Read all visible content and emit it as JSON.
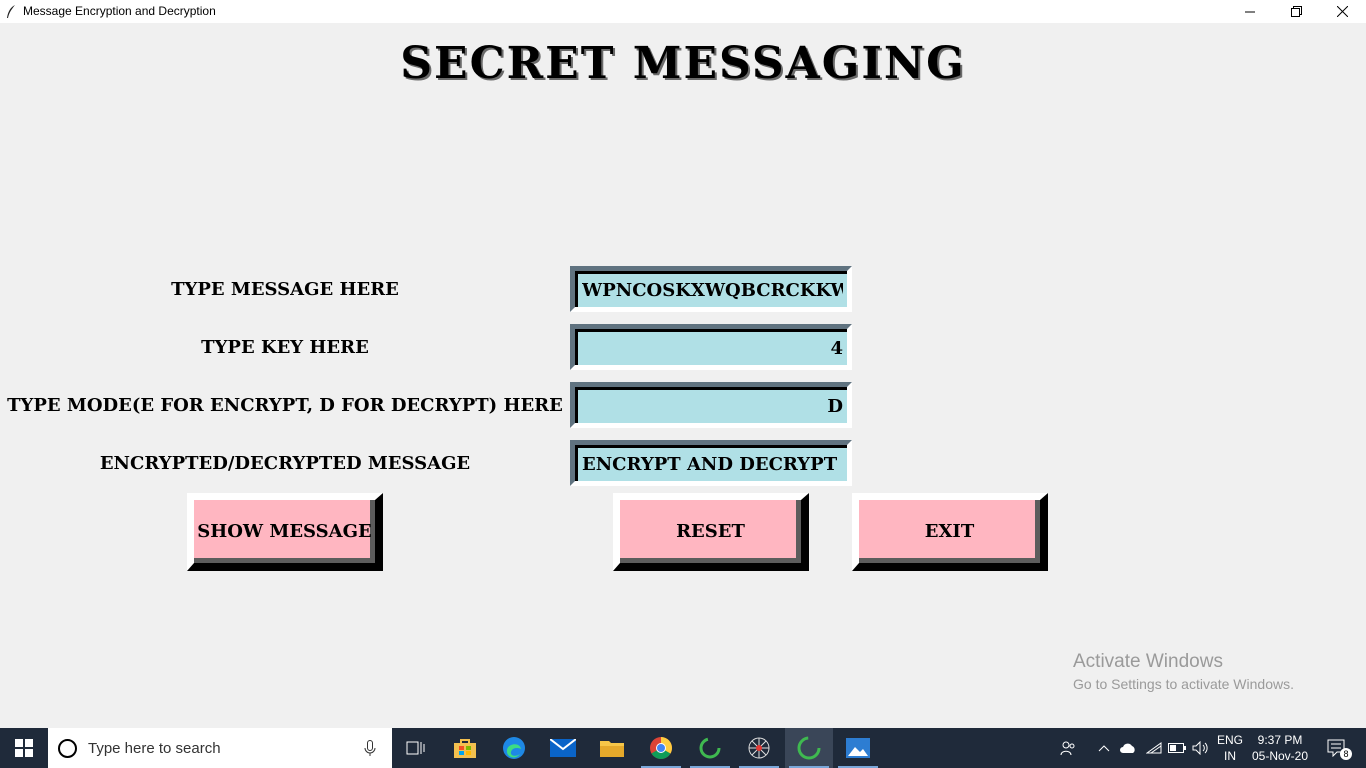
{
  "window": {
    "title": "Message Encryption and Decryption"
  },
  "heading": "SECRET MESSAGING",
  "form": {
    "message_label": "TYPE MESSAGE HERE",
    "message_value": "WPNCOSKXWQBCRCKKWQ",
    "key_label": "TYPE KEY HERE",
    "key_value": "4",
    "mode_label": "TYPE MODE(E FOR ENCRYPT, D FOR DECRYPT) HERE",
    "mode_value": "D",
    "result_label": "ENCRYPTED/DECRYPTED MESSAGE",
    "result_value": "ENCRYPT AND DECRYPT M"
  },
  "buttons": {
    "show": "SHOW MESSAGE",
    "reset": "RESET",
    "exit": "EXIT"
  },
  "colors": {
    "entry_bg": "#b0e0e6",
    "button_bg": "#ffb6c1",
    "window_bg": "#f0f0f0"
  },
  "watermark": {
    "line1": "Activate Windows",
    "line2": "Go to Settings to activate Windows."
  },
  "taskbar": {
    "search_placeholder": "Type here to search",
    "apps": [
      "task-view-icon",
      "store-icon",
      "edge-icon",
      "mail-icon",
      "file-explorer-icon",
      "chrome-icon",
      "spinner-app-icon",
      "spider-app-icon",
      "spinner-app-icon",
      "photos-icon"
    ],
    "language_line1": "ENG",
    "language_line2": "IN",
    "time": "9:37 PM",
    "date": "05-Nov-20",
    "notification_count": "8"
  }
}
